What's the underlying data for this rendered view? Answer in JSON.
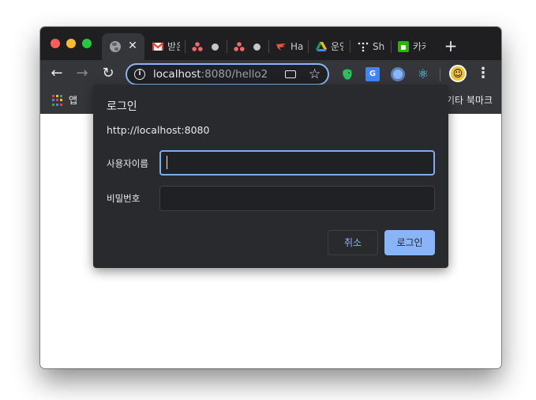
{
  "browser": {
    "tabs": [
      {
        "label": "",
        "icon": "globe-icon",
        "active": true
      },
      {
        "label": "받은",
        "icon": "gmail-icon"
      },
      {
        "label": "",
        "icon": "asana-icon"
      },
      {
        "label": "",
        "icon": "asana-icon"
      },
      {
        "label": "Ha",
        "icon": "bird-icon"
      },
      {
        "label": "운영",
        "icon": "google-drive-icon"
      },
      {
        "label": "Sh",
        "icon": "dots-icon"
      },
      {
        "label": "카카",
        "icon": "green-app-icon"
      }
    ],
    "url": {
      "host": "localhost",
      "rest": ":8080/hello2"
    },
    "bookmarks": {
      "apps_label": "앱",
      "other_label": "기타 북마크"
    }
  },
  "dialog": {
    "title": "로그인",
    "origin": "http://localhost:8080",
    "username_label": "사용자이름",
    "username_value": "",
    "password_label": "비밀번호",
    "password_value": "",
    "cancel_label": "취소",
    "login_label": "로그인"
  },
  "colors": {
    "accent": "#8ab4f8",
    "dialog_bg": "#292a2d",
    "chrome_dark": "#35363a"
  }
}
